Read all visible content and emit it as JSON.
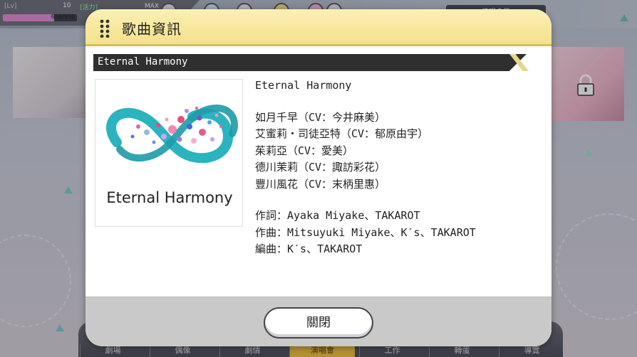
{
  "hud": {
    "level_label": "[Lv]",
    "level_value": "10",
    "stamina_label": "[活力]",
    "exp_text": "656/950",
    "exp_fraction": 0.69,
    "max_label": "MAX",
    "right_button_label": "演唱會業"
  },
  "bottom_nav": {
    "tabs": [
      "劇場",
      "偶像",
      "劇情",
      "演唱會",
      "工作",
      "轉蛋",
      "導覽"
    ],
    "active_index": 3
  },
  "dialog": {
    "title": "歌曲資訊",
    "song_strip_title": "Eternal Harmony",
    "jacket_caption": "Eternal Harmony",
    "song_name": "Eternal Harmony",
    "singers": [
      "如月千早（CV：今井麻美）",
      "艾蜜莉・司徒亞特（CV：郁原由宇）",
      "茱莉亞（CV：愛美）",
      "德川茉莉（CV：諏訪彩花）",
      "豐川風花（CV：末柄里惠）"
    ],
    "credits": {
      "lyrics": "作詞：Ayaka Miyake、TAKAROT",
      "composition": "作曲：Mitsuyuki Miyake、K′s、TAKAROT",
      "arrangement": "編曲：K′s、TAKAROT"
    },
    "close_label": "關閉"
  },
  "colors": {
    "header_yellow": "#f4e18c",
    "strip_dark": "#2f2f2f",
    "jacket_teal": "#2bb3bf",
    "nav_active": "#f2c23c"
  }
}
